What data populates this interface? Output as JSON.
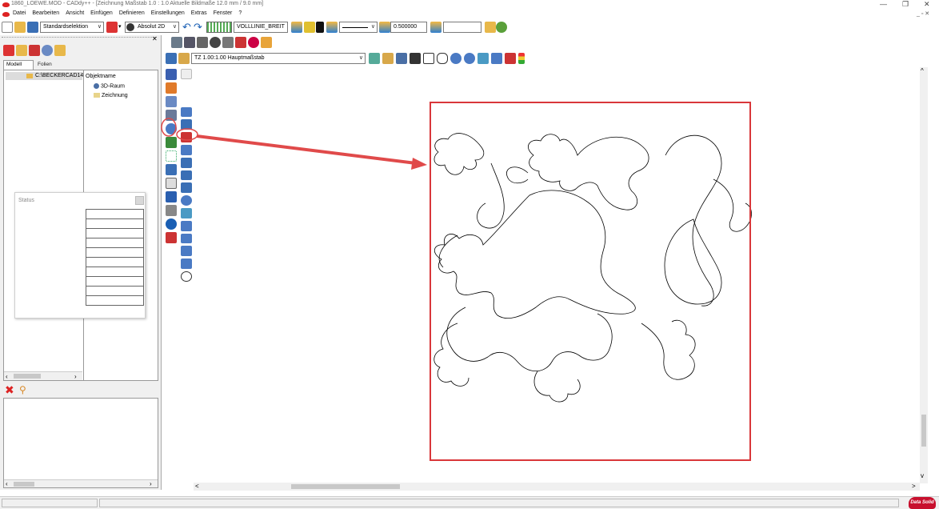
{
  "window": {
    "title": "1860_LOEWE.MOD  -  CADdy++ - [Zeichnung   Maßstab 1.0 : 1.0   Aktuelle Bildmaße 12.0 mm / 9.0 mm]",
    "minimize": "—",
    "maximize": "❐",
    "close": "✕",
    "inner_controls": "_ ▫ ✕"
  },
  "menu": [
    "Datei",
    "Bearbeiten",
    "Ansicht",
    "Einfügen",
    "Definieren",
    "Einstellungen",
    "Extras",
    "Fenster",
    "?"
  ],
  "toolbar": {
    "selection_mode": "Standardselektion",
    "coord_mode": "Absolut 2D",
    "linetype": "VOLLLINIE_BREIT",
    "linewidth": "0.500000",
    "empty_field": ""
  },
  "left": {
    "tab_model": "Modell",
    "tab_layers": "Folien",
    "tree_root": "C:\\BECKERCAD14",
    "col_header": "Objektname",
    "items": [
      "3D-Raum",
      "Zeichnung"
    ]
  },
  "status_panel": {
    "title": "Status",
    "rows": 10
  },
  "view_toolbar": {
    "scale_combo": "TZ 1.00:1.00 Hauptmaßstab"
  },
  "brand": "Data Solid",
  "colors": {
    "accent_red": "#e04a4a",
    "frame_red": "#d9373a"
  }
}
